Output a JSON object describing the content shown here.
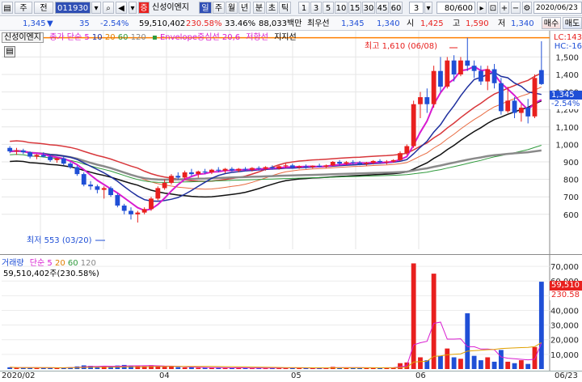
{
  "toolbar": {
    "menu1": "주",
    "menu2": "전",
    "stock_code": "011930",
    "stock_name": "신성이엔지",
    "period_selected": "일",
    "periods": [
      "주",
      "월",
      "년",
      "분",
      "초",
      "틱"
    ],
    "intervals": [
      "1",
      "3",
      "5",
      "10",
      "15",
      "30",
      "45",
      "60",
      "3"
    ],
    "count": "80/600",
    "date": "2020/06/23",
    "buy_label": "매수",
    "sell_label": "매도"
  },
  "info": {
    "price": "1,345",
    "change": "35",
    "change_pct": "-2.54%",
    "volume": "59,510,402",
    "vol_ratio": "230.58%",
    "turnover": "33.46%",
    "amount": "88,033백만",
    "best_ask_label": "최우선",
    "best_ask": "1,345",
    "best_bid": "1,340",
    "open_label": "시",
    "open": "1,425",
    "high_label": "고",
    "high": "1,590",
    "low_label": "저",
    "low": "1,340"
  },
  "price_legend": {
    "name": "신성이엔지",
    "ma_label": "종가 단순",
    "ma_periods": [
      "5",
      "10",
      "20",
      "60",
      "120"
    ],
    "envelope_label": "Envelope중심선 20,6",
    "resistance_label": "저항선",
    "support_label": "지지선",
    "right_label_1": "LC:143",
    "right_label_2": "HC:-16"
  },
  "volume_legend": {
    "name": "거래량",
    "ma_label": "단순",
    "ma_periods": [
      "5",
      "20",
      "60",
      "120"
    ],
    "summary": "59,510,402주(230.58%)"
  },
  "annotations": {
    "high": "최고 1,610 (06/08)",
    "low": "최저 553 (03/20)"
  },
  "price_tag": {
    "price": "1,345",
    "pct": "-2.54%"
  },
  "volume_tag": {
    "volume": "59,510",
    "pct": "230.58"
  },
  "colors": {
    "up": "#e8201e",
    "down": "#1f4fd6",
    "ma5": "#d81bd0",
    "ma10": "#1e2f9e",
    "ma20": "#e8201e",
    "ma60": "#000000",
    "ma120": "#8a8a8a",
    "envelope": "#2f9a3c",
    "resistance": "#ff7f00"
  },
  "chart_data": {
    "type": "candlestick",
    "y_ticks": [
      "1,500",
      "1,400",
      "1,300",
      "1,200",
      "1,100",
      "1,000",
      "900",
      "800",
      "700",
      "600"
    ],
    "ylim": [
      400,
      1650
    ],
    "vol_ticks": [
      "70,000",
      "60,000",
      "50,000",
      "40,000",
      "30,000",
      "20,000",
      "10,000"
    ],
    "vol_ylim": [
      0,
      75000
    ],
    "x_labels": [
      "2020/02",
      "04",
      "05",
      "06",
      "06/23"
    ],
    "resistance_value": 1610,
    "candles": [
      [
        980,
        990,
        950,
        960
      ],
      [
        960,
        980,
        940,
        965
      ],
      [
        965,
        975,
        945,
        955
      ],
      [
        955,
        960,
        920,
        930
      ],
      [
        930,
        945,
        915,
        940
      ],
      [
        940,
        955,
        925,
        930
      ],
      [
        930,
        940,
        900,
        910
      ],
      [
        910,
        925,
        895,
        920
      ],
      [
        920,
        930,
        880,
        890
      ],
      [
        890,
        900,
        860,
        870
      ],
      [
        870,
        880,
        820,
        830
      ],
      [
        830,
        840,
        760,
        770
      ],
      [
        770,
        790,
        740,
        760
      ],
      [
        760,
        770,
        720,
        740
      ],
      [
        740,
        760,
        690,
        750
      ],
      [
        750,
        760,
        700,
        710
      ],
      [
        710,
        720,
        640,
        650
      ],
      [
        650,
        660,
        600,
        620
      ],
      [
        620,
        640,
        570,
        600
      ],
      [
        600,
        620,
        553,
        610
      ],
      [
        610,
        640,
        600,
        630
      ],
      [
        630,
        700,
        620,
        690
      ],
      [
        690,
        760,
        680,
        750
      ],
      [
        750,
        800,
        740,
        780
      ],
      [
        780,
        830,
        770,
        820
      ],
      [
        820,
        840,
        800,
        810
      ],
      [
        810,
        850,
        800,
        840
      ],
      [
        840,
        860,
        820,
        830
      ],
      [
        830,
        850,
        810,
        845
      ],
      [
        845,
        860,
        830,
        840
      ],
      [
        840,
        860,
        830,
        855
      ],
      [
        855,
        870,
        840,
        850
      ],
      [
        850,
        865,
        835,
        860
      ],
      [
        860,
        870,
        845,
        850
      ],
      [
        850,
        865,
        840,
        860
      ],
      [
        860,
        870,
        845,
        855
      ],
      [
        855,
        870,
        845,
        865
      ],
      [
        865,
        875,
        850,
        860
      ],
      [
        860,
        875,
        850,
        870
      ],
      [
        870,
        880,
        855,
        862
      ],
      [
        862,
        880,
        855,
        875
      ],
      [
        875,
        890,
        865,
        880
      ],
      [
        880,
        890,
        860,
        868
      ],
      [
        868,
        880,
        860,
        875
      ],
      [
        875,
        885,
        860,
        870
      ],
      [
        870,
        880,
        862,
        878
      ],
      [
        878,
        890,
        868,
        872
      ],
      [
        872,
        885,
        865,
        880
      ],
      [
        880,
        905,
        875,
        900
      ],
      [
        900,
        910,
        880,
        890
      ],
      [
        890,
        905,
        882,
        898
      ],
      [
        898,
        910,
        885,
        895
      ],
      [
        895,
        905,
        880,
        888
      ],
      [
        888,
        900,
        878,
        895
      ],
      [
        895,
        910,
        885,
        905
      ],
      [
        905,
        915,
        890,
        898
      ],
      [
        898,
        910,
        885,
        902
      ],
      [
        902,
        915,
        895,
        910
      ],
      [
        910,
        960,
        905,
        950
      ],
      [
        950,
        1000,
        940,
        990
      ],
      [
        990,
        1250,
        980,
        1230
      ],
      [
        1230,
        1300,
        1150,
        1270
      ],
      [
        1270,
        1320,
        1180,
        1230
      ],
      [
        1230,
        1450,
        1210,
        1420
      ],
      [
        1420,
        1500,
        1300,
        1330
      ],
      [
        1330,
        1500,
        1320,
        1480
      ],
      [
        1480,
        1510,
        1360,
        1400
      ],
      [
        1400,
        1500,
        1390,
        1480
      ],
      [
        1480,
        1610,
        1420,
        1450
      ],
      [
        1450,
        1480,
        1380,
        1420
      ],
      [
        1420,
        1450,
        1340,
        1360
      ],
      [
        1360,
        1450,
        1310,
        1430
      ],
      [
        1430,
        1460,
        1320,
        1350
      ],
      [
        1350,
        1380,
        1170,
        1190
      ],
      [
        1190,
        1330,
        1180,
        1250
      ],
      [
        1250,
        1270,
        1150,
        1180
      ],
      [
        1180,
        1230,
        1130,
        1210
      ],
      [
        1210,
        1260,
        1120,
        1160
      ],
      [
        1160,
        1400,
        1150,
        1380
      ],
      [
        1425,
        1590,
        1340,
        1345
      ]
    ],
    "volume": [
      1200,
      900,
      800,
      1100,
      700,
      800,
      900,
      700,
      1000,
      1200,
      1800,
      2500,
      2200,
      1500,
      1800,
      1600,
      2400,
      2800,
      2300,
      2000,
      1900,
      2600,
      2200,
      1500,
      1800,
      1300,
      1100,
      1200,
      900,
      800,
      1000,
      900,
      700,
      800,
      900,
      700,
      600,
      800,
      700,
      900,
      800,
      700,
      900,
      800,
      700,
      600,
      800,
      700,
      1500,
      1100,
      900,
      800,
      700,
      900,
      1000,
      800,
      900,
      1100,
      4000,
      4500,
      72000,
      8000,
      6000,
      65000,
      9000,
      14000,
      8000,
      7000,
      38000,
      9000,
      6000,
      8000,
      5000,
      13000,
      5000,
      4000,
      6000,
      3500,
      15000,
      59510
    ]
  }
}
